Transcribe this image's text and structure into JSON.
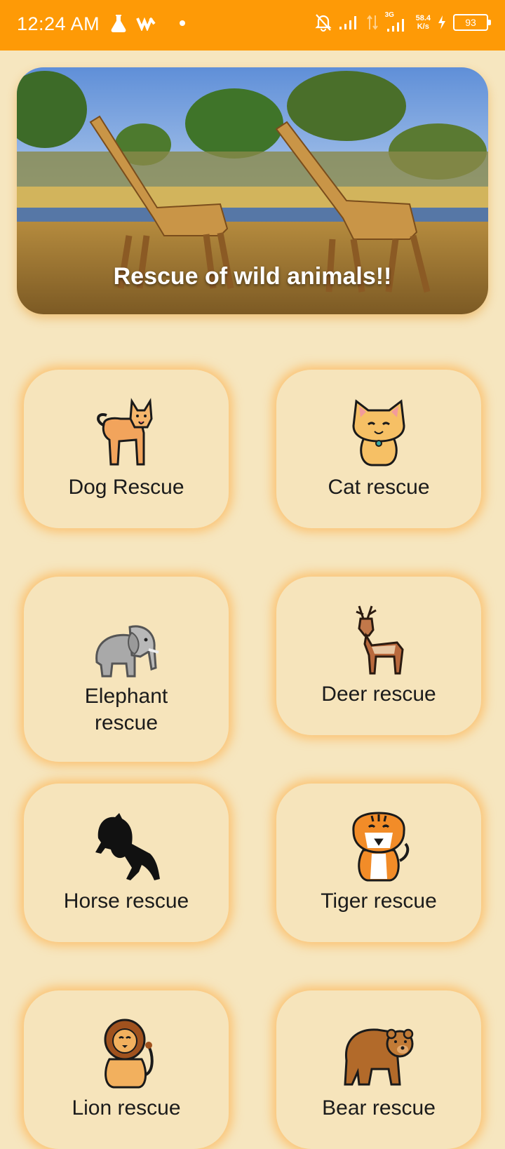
{
  "status_bar": {
    "time": "12:24 AM",
    "network_speed_value": "58.4",
    "network_speed_unit": "K/s",
    "network_type": "3G",
    "battery": "93"
  },
  "banner": {
    "caption": "Rescue of wild animals!!",
    "slides": 2,
    "active_slide": 2
  },
  "cards": [
    {
      "label": "Dog Rescue",
      "icon": "dog-icon"
    },
    {
      "label": "Cat rescue",
      "icon": "cat-icon"
    },
    {
      "label": "Elephant rescue",
      "icon": "elephant-icon"
    },
    {
      "label": "Deer rescue",
      "icon": "deer-icon"
    },
    {
      "label": "Horse rescue",
      "icon": "horse-icon"
    },
    {
      "label": "Tiger rescue",
      "icon": "tiger-icon"
    },
    {
      "label": "Lion rescue",
      "icon": "lion-icon"
    },
    {
      "label": "Bear rescue",
      "icon": "bear-icon"
    }
  ],
  "colors": {
    "status_bar": "#fe9a06",
    "background": "#f6e6bf",
    "card_glow": "#ffaa3c"
  }
}
